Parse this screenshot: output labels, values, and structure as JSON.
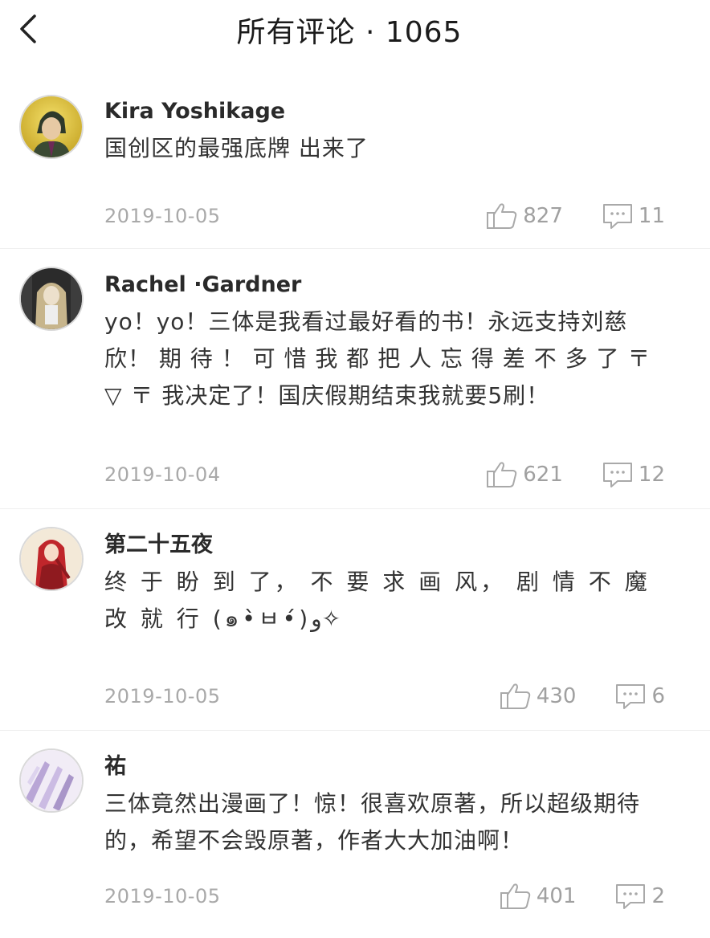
{
  "header": {
    "title": "所有评论 · 1065"
  },
  "comments": [
    {
      "username": "Kira Yoshikage",
      "text": "国创区的最强底牌 出来了",
      "date": "2019-10-05",
      "likes": "827",
      "replies": "11"
    },
    {
      "username": "Rachel ·Gardner",
      "text": "yo！yo！三体是我看过最好看的书！永远支持刘慈欣！ 期 待 ！ 可 惜 我 都 把 人 忘 得 差 不 多 了 〒 ▽ 〒  我决定了！国庆假期结束我就要5刷！",
      "date": "2019-10-04",
      "likes": "621",
      "replies": "12"
    },
    {
      "username": "第二十五夜",
      "text": "终 于 盼 到 了， 不 要 求 画 风， 剧 情 不 魔 改 就 行 (๑•̀ㅂ•́)و✧",
      "date": "2019-10-05",
      "likes": "430",
      "replies": "6"
    },
    {
      "username": "祐",
      "text": "三体竟然出漫画了！惊！很喜欢原著，所以超级期待的，希望不会毁原著，作者大大加油啊！",
      "date": "2019-10-05",
      "likes": "401",
      "replies": "2"
    }
  ],
  "colors": {
    "text_primary": "#2a2a2a",
    "text_secondary": "#a9a9a9",
    "divider": "#efefef",
    "background": "#ffffff"
  },
  "icons": {
    "back": "chevron-left-icon",
    "like": "thumbs-up-icon",
    "reply": "comment-bubble-icon"
  }
}
